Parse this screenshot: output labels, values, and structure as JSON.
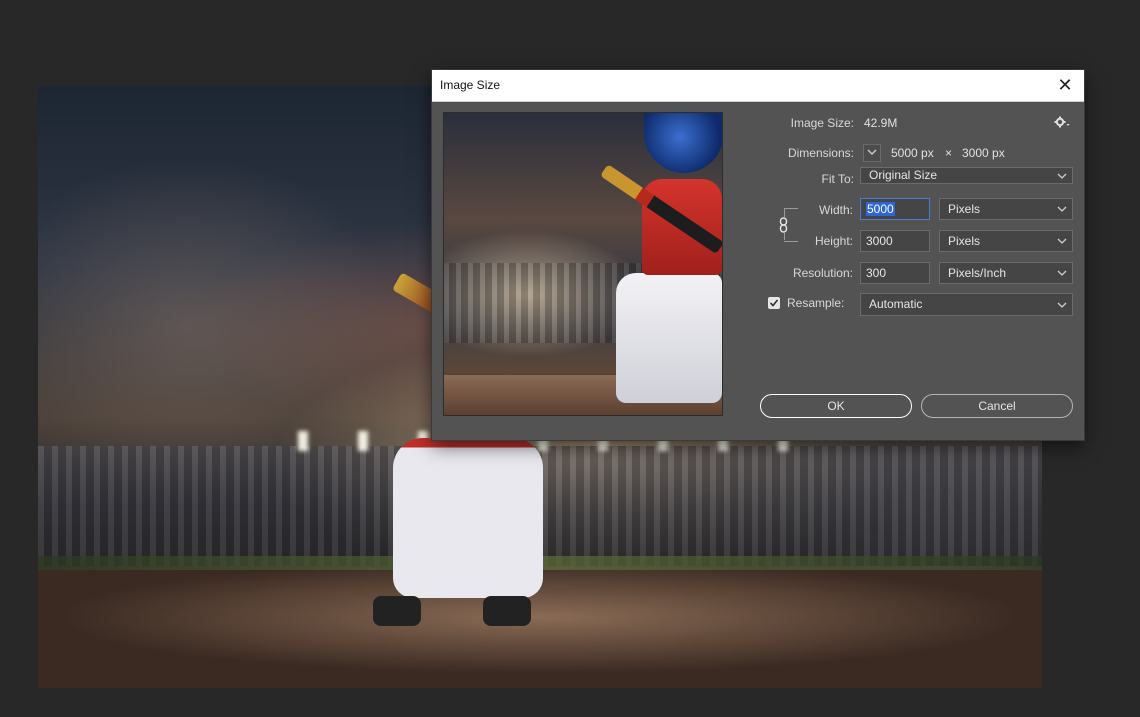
{
  "dialog": {
    "title": "Image Size",
    "close_glyph": "✕",
    "image_size_label": "Image Size:",
    "image_size_value": "42.9M",
    "dimensions_label": "Dimensions:",
    "dimensions_width": "5000 px",
    "dimensions_times": "×",
    "dimensions_height": "3000 px",
    "fit_to_label": "Fit To:",
    "fit_to_value": "Original Size",
    "width_label": "Width:",
    "width_value": "5000",
    "width_unit": "Pixels",
    "height_label": "Height:",
    "height_value": "3000",
    "height_unit": "Pixels",
    "resolution_label": "Resolution:",
    "resolution_value": "300",
    "resolution_unit": "Pixels/Inch",
    "resample_label": "Resample:",
    "resample_checked": true,
    "resample_value": "Automatic",
    "ok_label": "OK",
    "cancel_label": "Cancel"
  },
  "icons": {
    "settings": "gear-icon",
    "dimensions_menu": "chevron-down-icon",
    "constrain": "chain-link-icon",
    "close": "close-icon"
  },
  "colors": {
    "dialog_bg": "#535353",
    "app_bg": "#282828",
    "selection": "#2b66d3",
    "focus_border": "#4a7dd8"
  }
}
